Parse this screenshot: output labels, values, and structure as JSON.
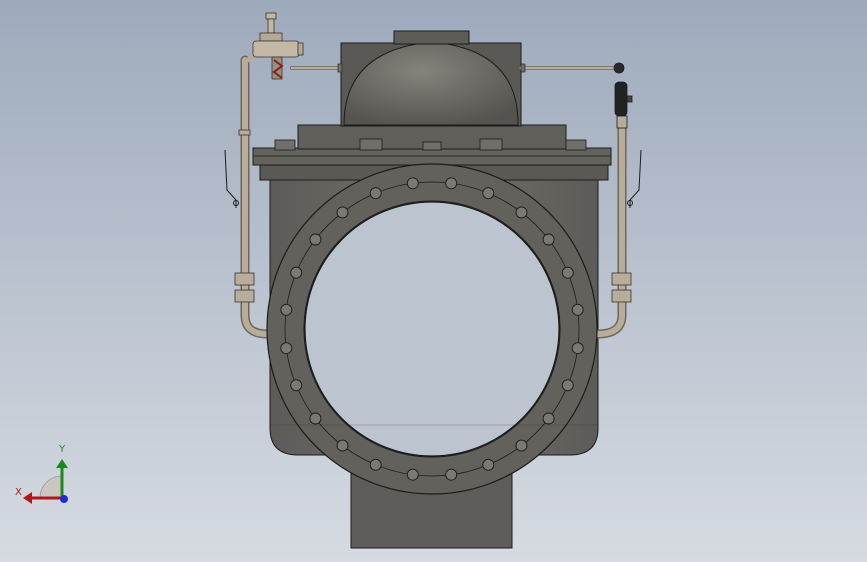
{
  "view": {
    "background_top": "#9eaabb",
    "background_bottom": "#d6dbe2",
    "model_body_color": "#6b6a66",
    "model_edge_color": "#1c1c1c",
    "pipe_color": "#b0a494"
  },
  "triad": {
    "x_label": "X",
    "y_label": "Y",
    "x_color": "#b01818",
    "y_color": "#1a8a1a",
    "z_color": "#1b2bd6"
  },
  "flange": {
    "bolt_count": 24
  }
}
